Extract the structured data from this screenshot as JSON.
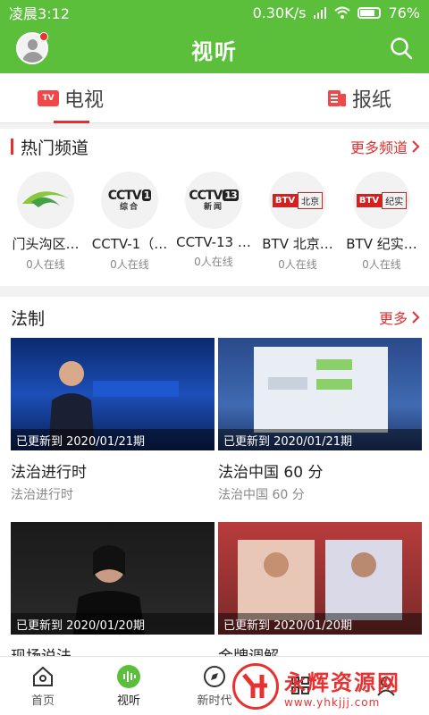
{
  "statusbar": {
    "time": "凌晨3:12",
    "speed": "0.30K/s",
    "battery": "76%"
  },
  "appbar": {
    "title": "视听"
  },
  "tabs": [
    {
      "label": "电视",
      "icon": "tv-icon",
      "active": true
    },
    {
      "label": "报纸",
      "icon": "newspaper-icon",
      "active": false
    }
  ],
  "tv_icon_text": "TV",
  "hot": {
    "title": "热门频道",
    "more": "更多频道",
    "channels": [
      {
        "name": "门头沟区…",
        "viewers": "0人在线",
        "logo": "mentougou-logo"
      },
      {
        "name": "CCTV-1（…",
        "viewers": "0人在线",
        "logo": "cctv1-logo",
        "cctv": "CCTV",
        "num": "1",
        "sub": "综合"
      },
      {
        "name": "CCTV-13 …",
        "viewers": "0人在线",
        "logo": "cctv13-logo",
        "cctv": "CCTV",
        "num": "13",
        "sub": "新闻"
      },
      {
        "name": "BTV 北京…",
        "viewers": "0人在线",
        "logo": "btv-beijing-logo",
        "btv": "BTV",
        "sub": "北京"
      },
      {
        "name": "BTV 纪实…",
        "viewers": "0人在线",
        "logo": "btv-jishi-logo",
        "btv": "BTV",
        "sub": "纪实"
      }
    ]
  },
  "law": {
    "title": "法制",
    "more": "更多",
    "videos": [
      {
        "badge": "已更新到 2020/01/21期",
        "title": "法治进行时",
        "subtitle": "法治进行时"
      },
      {
        "badge": "已更新到 2020/01/21期",
        "title": "法治中国 60 分",
        "subtitle": "法治中国 60 分"
      },
      {
        "badge": "已更新到 2020/01/20期",
        "title": "现场说法",
        "subtitle": ""
      },
      {
        "badge": "已更新到 2020/01/20期",
        "title": "金牌调解",
        "subtitle": ""
      }
    ]
  },
  "bottomnav": [
    {
      "label": "首页",
      "icon": "home-icon"
    },
    {
      "label": "视听",
      "icon": "audio-wave-icon",
      "active": true
    },
    {
      "label": "新时代",
      "icon": "compass-icon"
    },
    {
      "label": "",
      "icon": "grid-icon"
    },
    {
      "label": "",
      "icon": "user-icon"
    }
  ],
  "watermark": {
    "text": "永辉资源网",
    "url": "www.yhkjjj.com"
  },
  "colors": {
    "brand_green": "#5cbf3c",
    "accent_red": "#e23030"
  }
}
